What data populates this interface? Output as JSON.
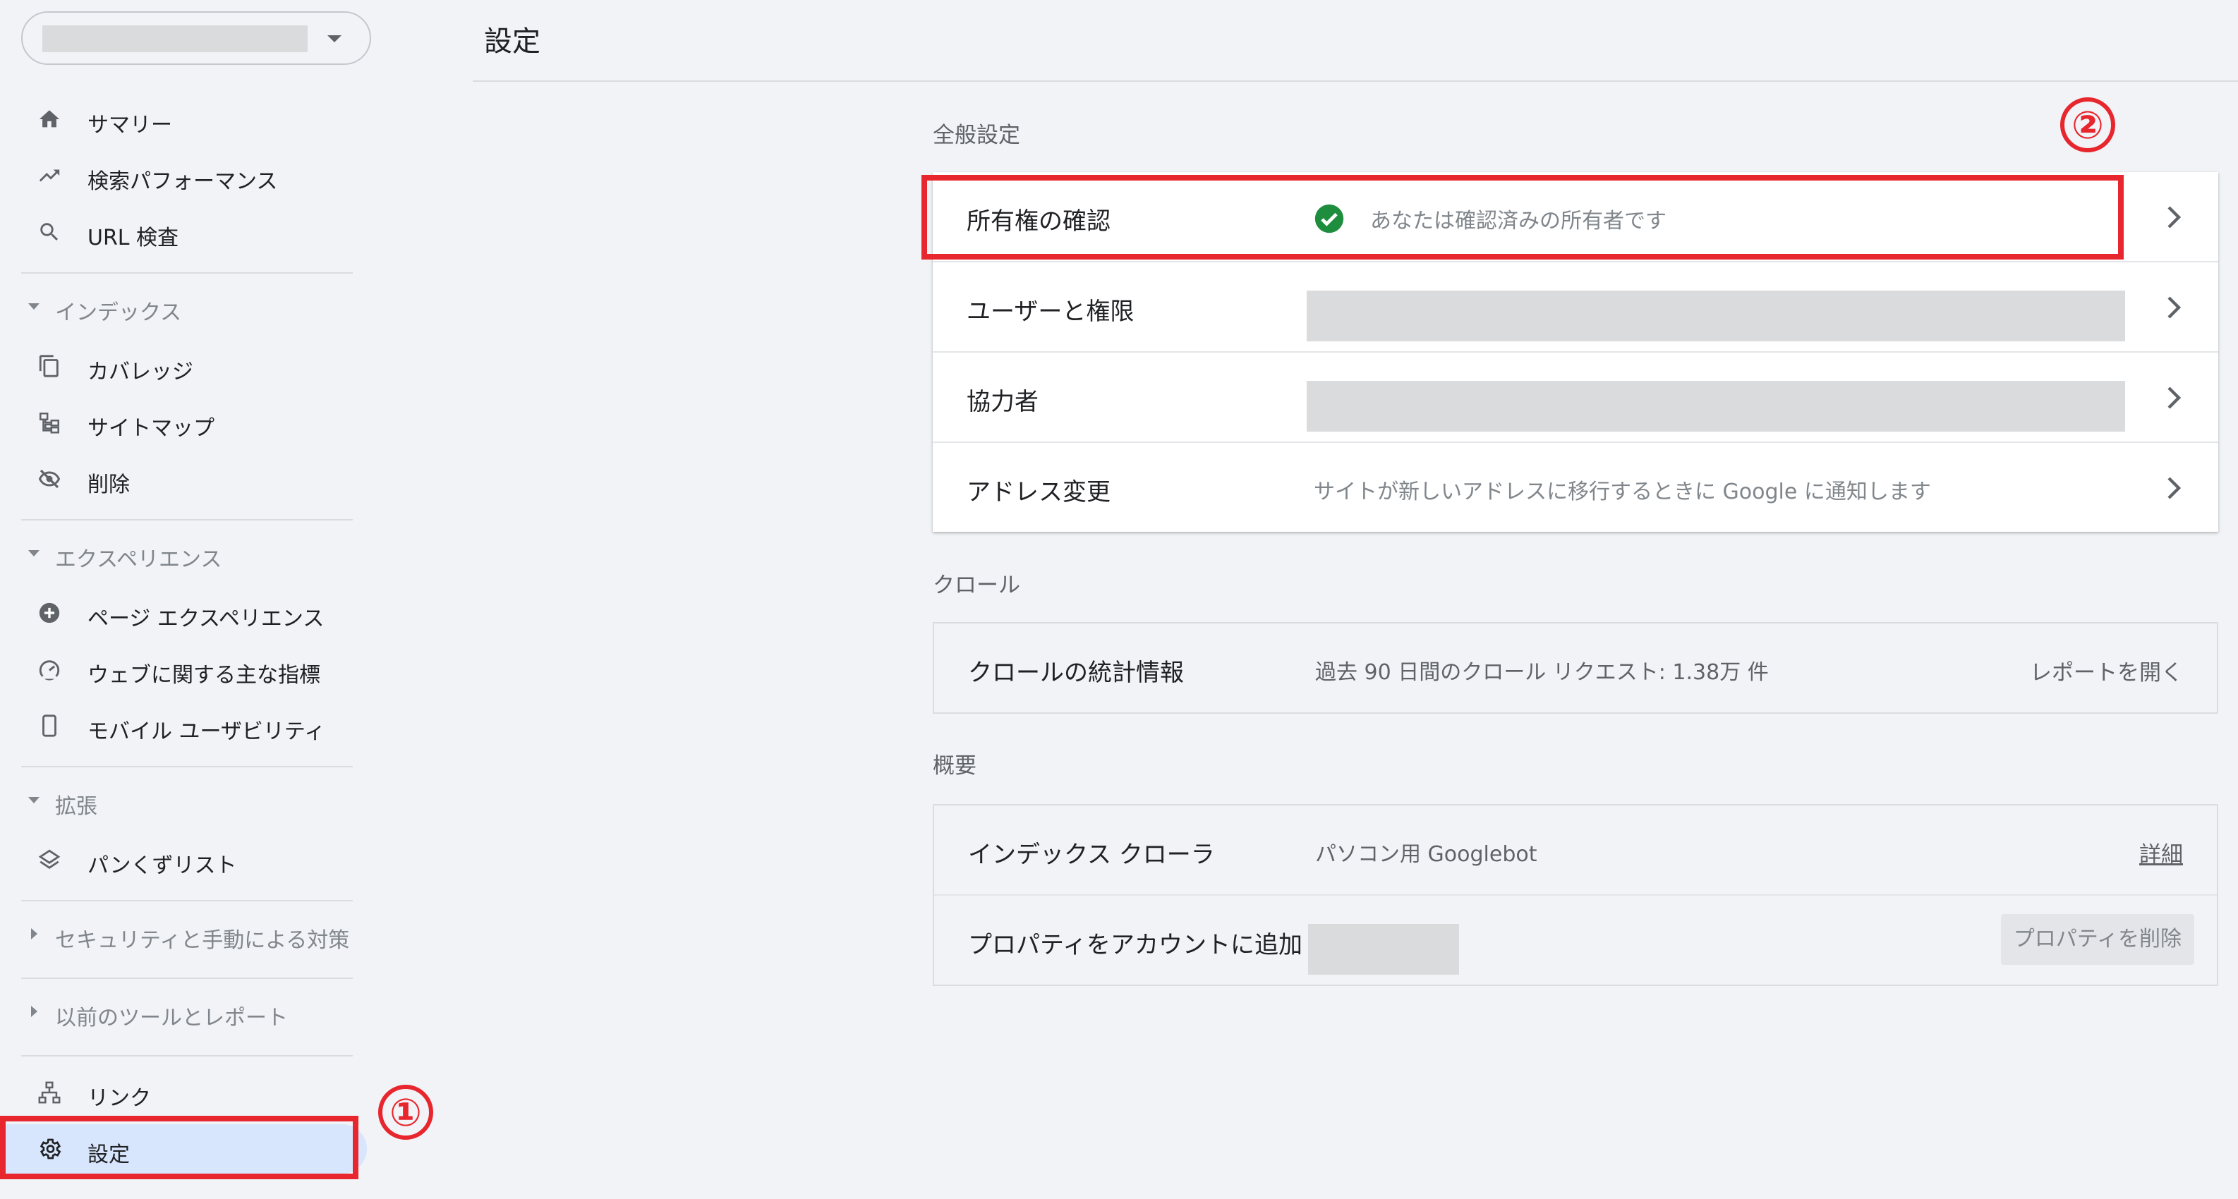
{
  "sidebar": {
    "property_selector": {
      "value": ""
    },
    "items": [
      {
        "label": "サマリー",
        "icon": "home-icon"
      },
      {
        "label": "検索パフォーマンス",
        "icon": "trending-up-icon"
      },
      {
        "label": "URL 検査",
        "icon": "search-icon"
      }
    ],
    "sections": {
      "index": {
        "label": "インデックス",
        "items": [
          {
            "label": "カバレッジ",
            "icon": "copy-icon"
          },
          {
            "label": "サイトマップ",
            "icon": "sitemap-icon"
          },
          {
            "label": "削除",
            "icon": "visibility-off-icon"
          }
        ]
      },
      "experience": {
        "label": "エクスペリエンス",
        "items": [
          {
            "label": "ページ エクスペリエンス",
            "icon": "add-circle-icon"
          },
          {
            "label": "ウェブに関する主な指標",
            "icon": "speed-gauge-icon"
          },
          {
            "label": "モバイル ユーザビリティ",
            "icon": "smartphone-icon"
          }
        ]
      },
      "enhancements": {
        "label": "拡張",
        "items": [
          {
            "label": "パンくずリスト",
            "icon": "layers-icon"
          }
        ]
      },
      "security": {
        "label": "セキュリティと手動による対策"
      },
      "legacy": {
        "label": "以前のツールとレポート"
      }
    },
    "links": {
      "label": "リンク",
      "icon": "links-icon"
    },
    "settings": {
      "label": "設定",
      "icon": "gear-icon",
      "active": true
    }
  },
  "annotations": {
    "one": "①",
    "two": "②",
    "color": "#e7262d"
  },
  "main": {
    "title": "設定",
    "general": {
      "label": "全般設定",
      "rows": [
        {
          "name": "所有権の確認",
          "value": "あなたは確認済みの所有者です",
          "status_color": "#1e8e3e"
        },
        {
          "name": "ユーザーと権限",
          "value": ""
        },
        {
          "name": "協力者",
          "value": ""
        },
        {
          "name": "アドレス変更",
          "value": "サイトが新しいアドレスに移行するときに Google に通知します"
        }
      ]
    },
    "crawl": {
      "label": "クロール",
      "row": {
        "name": "クロールの統計情報",
        "value": "過去 90 日間のクロール リクエスト: 1.38万 件",
        "action": "レポートを開く"
      }
    },
    "overview": {
      "label": "概要",
      "rows": [
        {
          "name": "インデックス クローラ",
          "value": "パソコン用 Googlebot",
          "action": "詳細"
        },
        {
          "name": "プロパティをアカウントに追加",
          "value": "",
          "action": "プロパティを削除"
        }
      ]
    }
  }
}
